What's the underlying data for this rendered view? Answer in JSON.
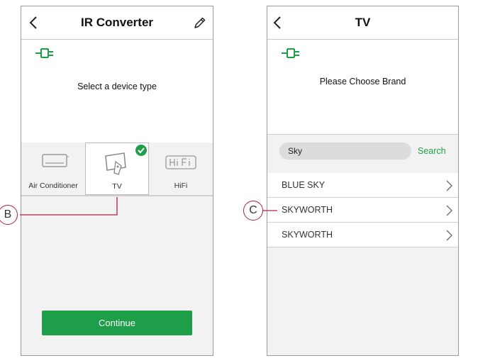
{
  "left_screen": {
    "title": "IR Converter",
    "prompt": "Select a device type",
    "devices": [
      {
        "label": "Air Conditioner",
        "selected": false
      },
      {
        "label": "TV",
        "selected": true
      },
      {
        "label": "HiFi",
        "selected": false
      }
    ],
    "continue_label": "Continue",
    "icons": {
      "back": "chevron-left-icon",
      "edit": "pencil-icon",
      "ir": "ir-plug-icon",
      "check": "check-circle-icon"
    }
  },
  "right_screen": {
    "title": "TV",
    "prompt": "Please Choose Brand",
    "search": {
      "value": "Sky",
      "button_label": "Search"
    },
    "brands": [
      {
        "label": "BLUE SKY"
      },
      {
        "label": "SKYWORTH"
      },
      {
        "label": "SKYWORTH"
      }
    ]
  },
  "callouts": {
    "b": "B",
    "c": "C"
  },
  "colors": {
    "accent": "#1f9e4a",
    "callout": "#b0203a",
    "panel_bg": "#f2f2f2"
  }
}
